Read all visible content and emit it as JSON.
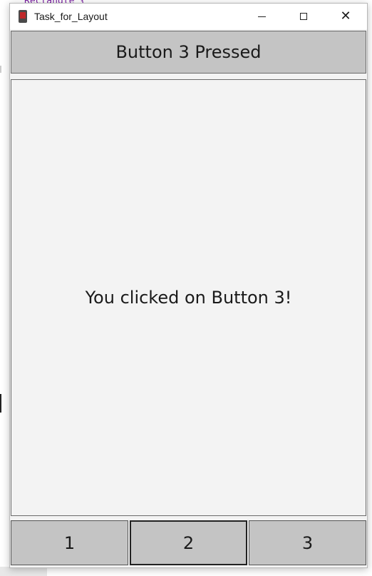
{
  "background": {
    "code_snippet": "Rectangle {"
  },
  "window": {
    "title": "Task_for_Layout",
    "controls": {
      "minimize": "minimize-icon",
      "maximize": "maximize-icon",
      "close": "close-icon"
    }
  },
  "header": {
    "label": "Button 3 Pressed"
  },
  "main": {
    "message": "You clicked on Button 3!"
  },
  "buttons": [
    {
      "label": "1"
    },
    {
      "label": "2"
    },
    {
      "label": "3"
    }
  ],
  "colors": {
    "button_fill": "#c4c4c4",
    "panel_fill": "#f3f3f3",
    "titlebar": "#ffffff"
  }
}
